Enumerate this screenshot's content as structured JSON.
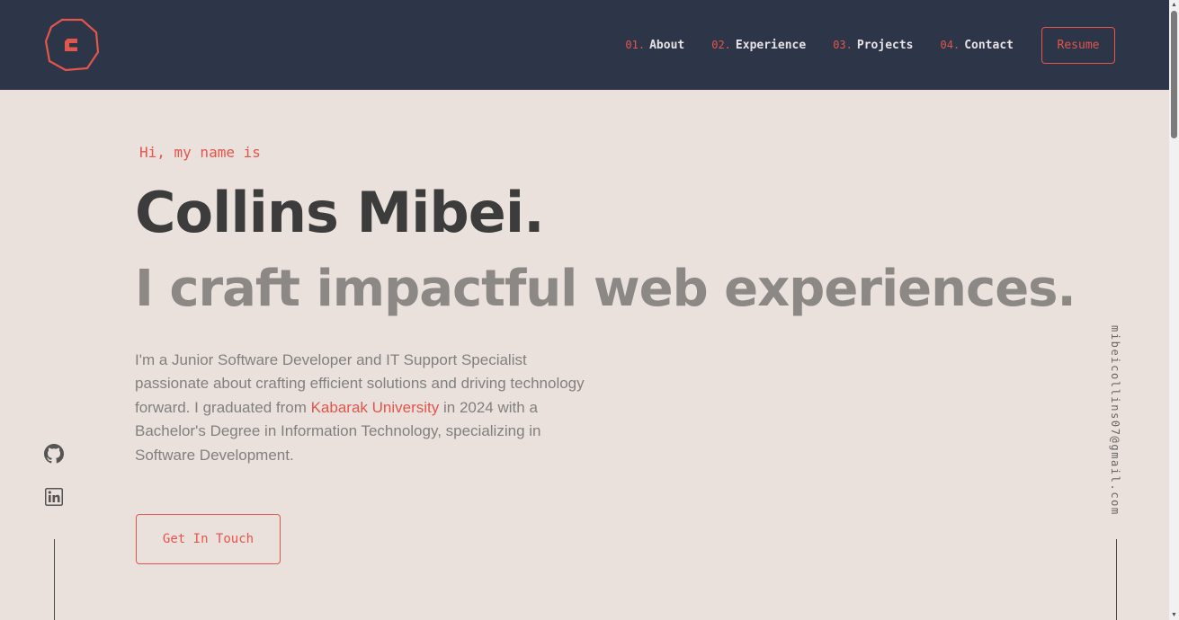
{
  "header": {
    "nav": [
      {
        "num": "01.",
        "label": "About"
      },
      {
        "num": "02.",
        "label": "Experience"
      },
      {
        "num": "03.",
        "label": "Projects"
      },
      {
        "num": "04.",
        "label": "Contact"
      }
    ],
    "resume_label": "Resume"
  },
  "hero": {
    "greeting": "Hi, my name is",
    "name": "Collins Mibei.",
    "tagline": "I craft impactful web experiences.",
    "bio_before": "I'm a Junior Software Developer and IT Support Specialist passionate about crafting efficient solutions and driving technology forward. I graduated from ",
    "bio_link": "Kabarak University",
    "bio_after": " in 2024 with a Bachelor's Degree in Information Technology, specializing in Software Development.",
    "cta_label": "Get In Touch"
  },
  "side": {
    "email": "mibeicollins07@gmail.com",
    "social_icons": [
      "github-icon",
      "linkedin-icon"
    ]
  },
  "colors": {
    "accent": "#e2564b",
    "header_bg": "#2d3548",
    "page_bg": "#ebe1dc",
    "heading": "#3c3c3c",
    "subheading": "#8b8885"
  }
}
